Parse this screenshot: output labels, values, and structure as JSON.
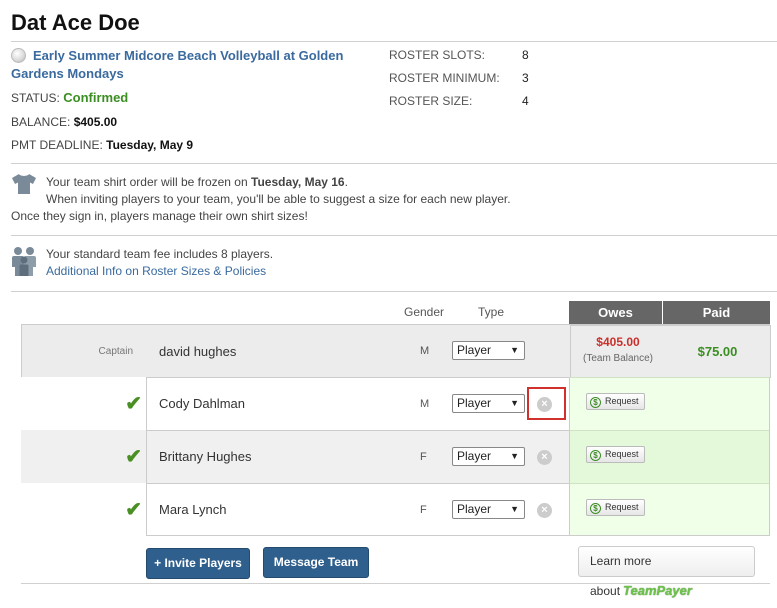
{
  "header": {
    "title": "Dat Ace Doe"
  },
  "league": {
    "name": "Early Summer Midcore Beach Volleyball at Golden Gardens Mondays",
    "status_label": "STATUS:",
    "status_value": "Confirmed",
    "balance_label": "BALANCE:",
    "balance_value": "$405.00",
    "deadline_label": "PMT DEADLINE:",
    "deadline_value": "Tuesday, May 9"
  },
  "roster_stats": [
    {
      "label": "ROSTER SLOTS:",
      "value": "8"
    },
    {
      "label": "ROSTER MINIMUM:",
      "value": "3"
    },
    {
      "label": "ROSTER SIZE:",
      "value": "4"
    }
  ],
  "shirt_notice": {
    "line1_prefix": "Your team shirt order will be frozen on",
    "line1_date": "Tuesday, May 16",
    "line2": "When inviting players to your team, you'll be able to suggest a size for each new player.",
    "line3": "Once they sign in, players manage their own shirt sizes!"
  },
  "fee_notice": {
    "text": "Your standard team fee includes 8 players.",
    "link": "Additional Info on Roster Sizes & Policies"
  },
  "table": {
    "headers": {
      "gender": "Gender",
      "type": "Type",
      "owes": "Owes",
      "paid": "Paid"
    },
    "captain": {
      "role": "Captain",
      "name": "david hughes",
      "gender": "M",
      "type": "Player",
      "owes": "$405.00",
      "owes_note": "(Team Balance)",
      "paid": "$75.00"
    },
    "players": [
      {
        "name": "Cody Dahlman",
        "gender": "M",
        "type": "Player",
        "request": "Request"
      },
      {
        "name": "Brittany Hughes",
        "gender": "F",
        "type": "Player",
        "request": "Request"
      },
      {
        "name": "Mara Lynch",
        "gender": "F",
        "type": "Player",
        "request": "Request"
      }
    ]
  },
  "actions": {
    "invite": "+ Invite Players",
    "message": "Message Team",
    "learn_prefix": "Learn more about",
    "learn_brand": "TeamPayer"
  },
  "colors": {
    "accent": "#2f5f8c",
    "confirmed": "#3b8e22",
    "owes": "#c9302c",
    "highlight": "#d0312d"
  }
}
